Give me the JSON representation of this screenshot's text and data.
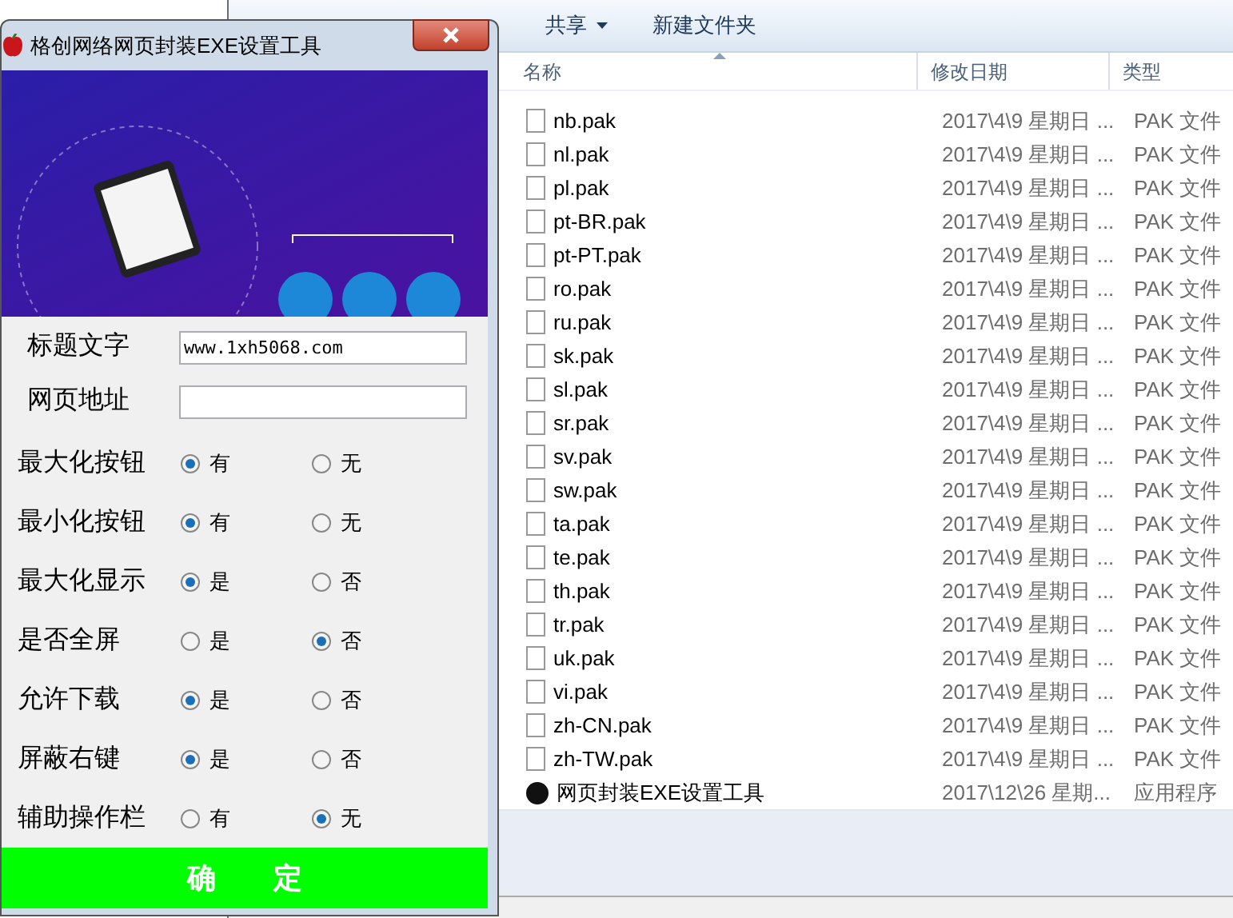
{
  "explorer": {
    "toolbar": [
      {
        "label": "共享",
        "menu": true
      },
      {
        "label": "新建文件夹",
        "menu": false
      }
    ],
    "columns": [
      {
        "label": "名称",
        "sorted": true
      },
      {
        "label": "修改日期",
        "sorted": false
      },
      {
        "label": "类型",
        "sorted": false
      }
    ],
    "files": [
      {
        "kind": "file",
        "name": "nb.pak",
        "date": "2017\\4\\9 星期日 ...",
        "type": "PAK 文件"
      },
      {
        "kind": "file",
        "name": "nl.pak",
        "date": "2017\\4\\9 星期日 ...",
        "type": "PAK 文件"
      },
      {
        "kind": "file",
        "name": "pl.pak",
        "date": "2017\\4\\9 星期日 ...",
        "type": "PAK 文件"
      },
      {
        "kind": "file",
        "name": "pt-BR.pak",
        "date": "2017\\4\\9 星期日 ...",
        "type": "PAK 文件"
      },
      {
        "kind": "file",
        "name": "pt-PT.pak",
        "date": "2017\\4\\9 星期日 ...",
        "type": "PAK 文件"
      },
      {
        "kind": "file",
        "name": "ro.pak",
        "date": "2017\\4\\9 星期日 ...",
        "type": "PAK 文件"
      },
      {
        "kind": "file",
        "name": "ru.pak",
        "date": "2017\\4\\9 星期日 ...",
        "type": "PAK 文件"
      },
      {
        "kind": "file",
        "name": "sk.pak",
        "date": "2017\\4\\9 星期日 ...",
        "type": "PAK 文件"
      },
      {
        "kind": "file",
        "name": "sl.pak",
        "date": "2017\\4\\9 星期日 ...",
        "type": "PAK 文件"
      },
      {
        "kind": "file",
        "name": "sr.pak",
        "date": "2017\\4\\9 星期日 ...",
        "type": "PAK 文件"
      },
      {
        "kind": "file",
        "name": "sv.pak",
        "date": "2017\\4\\9 星期日 ...",
        "type": "PAK 文件"
      },
      {
        "kind": "file",
        "name": "sw.pak",
        "date": "2017\\4\\9 星期日 ...",
        "type": "PAK 文件"
      },
      {
        "kind": "file",
        "name": "ta.pak",
        "date": "2017\\4\\9 星期日 ...",
        "type": "PAK 文件"
      },
      {
        "kind": "file",
        "name": "te.pak",
        "date": "2017\\4\\9 星期日 ...",
        "type": "PAK 文件"
      },
      {
        "kind": "file",
        "name": "th.pak",
        "date": "2017\\4\\9 星期日 ...",
        "type": "PAK 文件"
      },
      {
        "kind": "file",
        "name": "tr.pak",
        "date": "2017\\4\\9 星期日 ...",
        "type": "PAK 文件"
      },
      {
        "kind": "file",
        "name": "uk.pak",
        "date": "2017\\4\\9 星期日 ...",
        "type": "PAK 文件"
      },
      {
        "kind": "file",
        "name": "vi.pak",
        "date": "2017\\4\\9 星期日 ...",
        "type": "PAK 文件"
      },
      {
        "kind": "file",
        "name": "zh-CN.pak",
        "date": "2017\\4\\9 星期日 ...",
        "type": "PAK 文件"
      },
      {
        "kind": "file",
        "name": "zh-TW.pak",
        "date": "2017\\4\\9 星期日 ...",
        "type": "PAK 文件"
      },
      {
        "kind": "app",
        "name": "网页封装EXE设置工具",
        "date": "2017\\12\\26 星期...",
        "type": "应用程序"
      }
    ]
  },
  "dialog": {
    "title": "格创网络网页封装EXE设置工具",
    "fields": [
      {
        "label": "标题文字",
        "value": "www.1xh5068.com"
      },
      {
        "label": "网页地址"
      }
    ],
    "options": [
      {
        "label": "最大化按钮",
        "choices": [
          {
            "label": "有",
            "selected": true
          },
          {
            "label": "无",
            "selected": false
          }
        ]
      },
      {
        "label": "最小化按钮",
        "choices": [
          {
            "label": "有",
            "selected": true
          },
          {
            "label": "无",
            "selected": false
          }
        ]
      },
      {
        "label": "最大化显示",
        "choices": [
          {
            "label": "是",
            "selected": true
          },
          {
            "label": "否",
            "selected": false
          }
        ]
      },
      {
        "label": "是否全屏",
        "choices": [
          {
            "label": "是",
            "selected": false
          },
          {
            "label": "否",
            "selected": true
          }
        ]
      },
      {
        "label": "允许下载",
        "choices": [
          {
            "label": "是",
            "selected": true
          },
          {
            "label": "否",
            "selected": false
          }
        ]
      },
      {
        "label": "屏蔽右键",
        "choices": [
          {
            "label": "是",
            "selected": true
          },
          {
            "label": "否",
            "selected": false
          }
        ]
      },
      {
        "label": "辅助操作栏",
        "choices": [
          {
            "label": "有",
            "selected": false
          },
          {
            "label": "无",
            "selected": true
          }
        ]
      }
    ],
    "confirm_button": "确　　定"
  }
}
